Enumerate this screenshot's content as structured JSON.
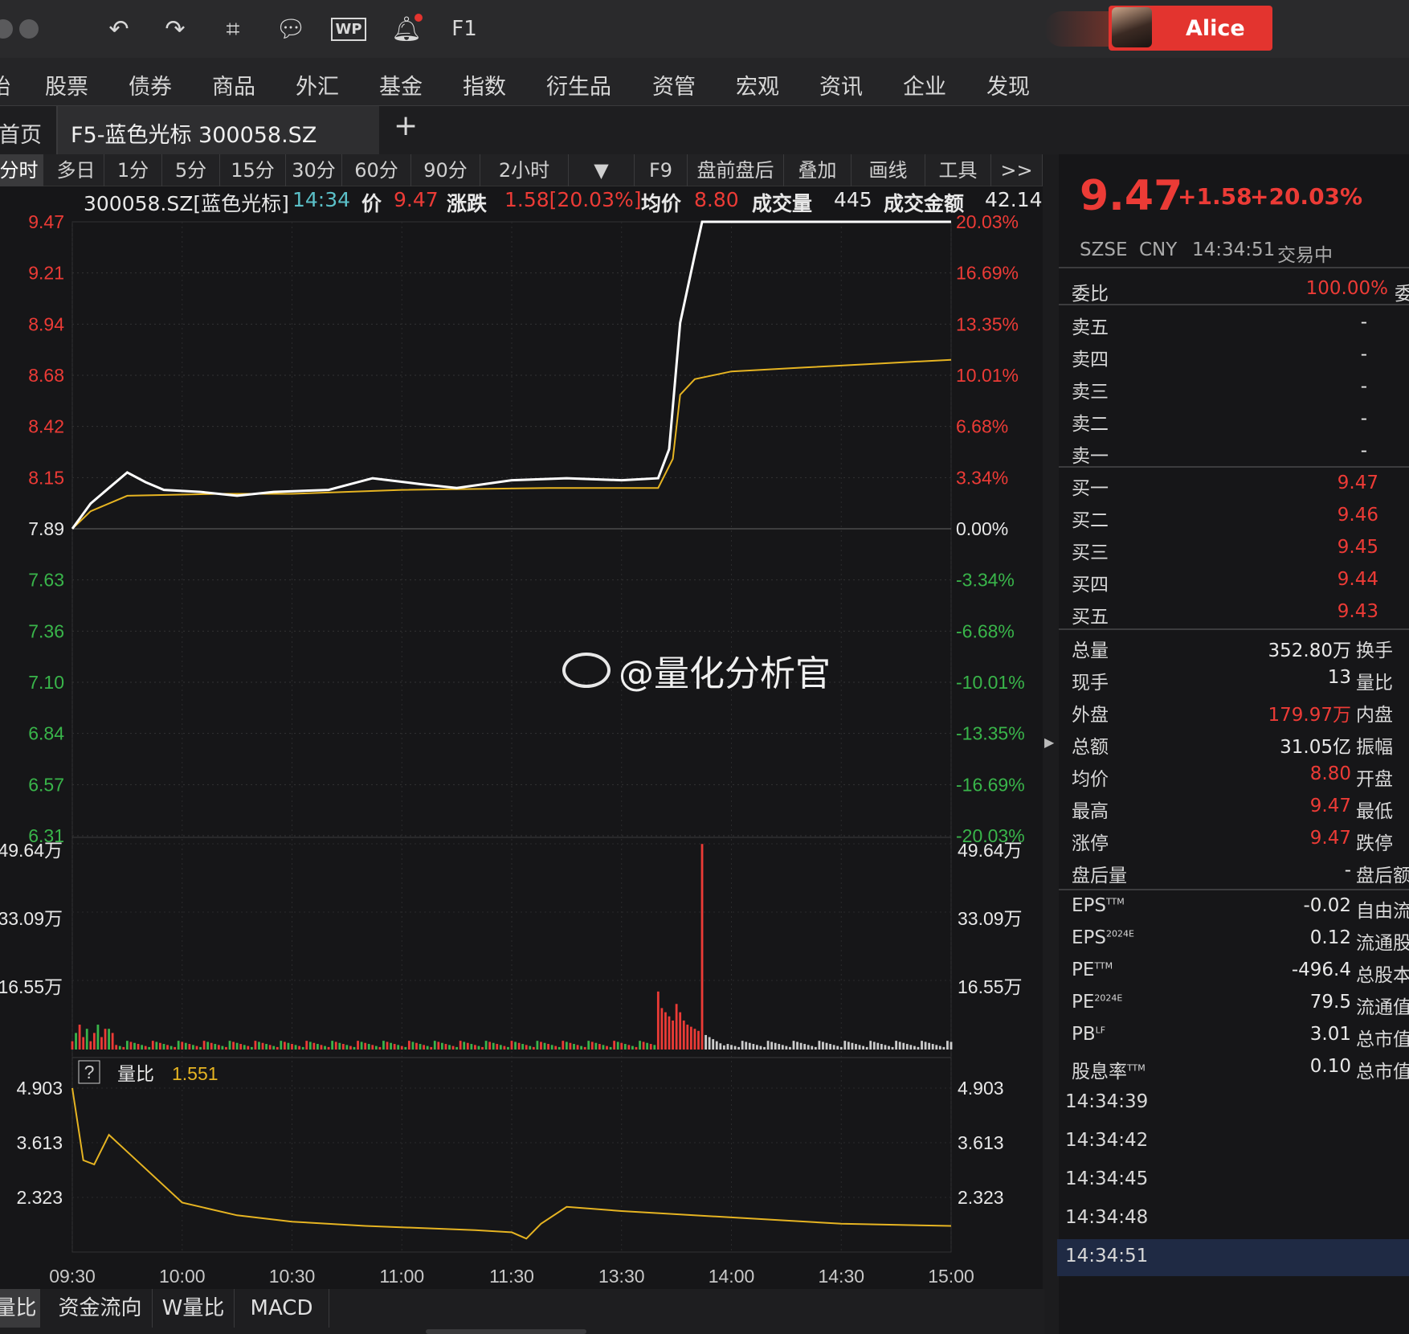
{
  "toolbar": {
    "user_name": "Alice",
    "f1_label": "F1"
  },
  "menu": [
    "股票",
    "债券",
    "商品",
    "外汇",
    "基金",
    "指数",
    "衍生品",
    "资管",
    "宏观",
    "资讯",
    "企业",
    "发现"
  ],
  "menu_cut": "始",
  "tabs": {
    "home": "首页",
    "active": "F5-蓝色光标 300058.SZ",
    "add": "+"
  },
  "periods": [
    "分时",
    "多日",
    "1分",
    "5分",
    "15分",
    "30分",
    "60分",
    "90分",
    "2小时",
    "F9",
    "盘前盘后",
    "叠加",
    "画线",
    "工具",
    ">>"
  ],
  "info": {
    "code": "300058.SZ[蓝色光标]",
    "time": "14:34",
    "price_label": "价",
    "price": "9.47",
    "change_label": "涨跌",
    "change": "1.58[20.03%]",
    "avg_label": "均价",
    "avg": "8.80",
    "vol_label": "成交量",
    "vol": "445",
    "amount_label": "成交金额",
    "amount": "42.14"
  },
  "watermark": "@量化分析官",
  "chart_data": {
    "type": "line",
    "price_axis": [
      "9.47",
      "9.21",
      "8.94",
      "8.68",
      "8.42",
      "8.15",
      "7.89",
      "7.63",
      "7.36",
      "7.10",
      "6.84",
      "6.57",
      "6.31"
    ],
    "pct_axis": [
      "20.03%",
      "16.69%",
      "13.35%",
      "10.01%",
      "6.68%",
      "3.34%",
      "0.00%",
      "-3.34%",
      "-6.68%",
      "-10.01%",
      "-13.35%",
      "-16.69%",
      "-20.03%"
    ],
    "volume_axis": [
      "49.64万",
      "33.09万",
      "16.55万"
    ],
    "ratio_label": "量比",
    "ratio_value": "1.551",
    "ratio_axis": [
      "4.903",
      "3.613",
      "2.323"
    ],
    "time_axis": [
      "09:30",
      "10:00",
      "10:30",
      "11:00",
      "11:30",
      "13:30",
      "14:00",
      "14:30",
      "15:00"
    ],
    "price_series": [
      [
        0,
        7.89
      ],
      [
        5,
        8.02
      ],
      [
        10,
        8.1
      ],
      [
        15,
        8.18
      ],
      [
        20,
        8.13
      ],
      [
        25,
        8.09
      ],
      [
        35,
        8.08
      ],
      [
        45,
        8.06
      ],
      [
        55,
        8.08
      ],
      [
        70,
        8.09
      ],
      [
        82,
        8.15
      ],
      [
        95,
        8.12
      ],
      [
        105,
        8.1
      ],
      [
        120,
        8.14
      ],
      [
        135,
        8.15
      ],
      [
        150,
        8.14
      ],
      [
        160,
        8.15
      ],
      [
        163,
        8.3
      ],
      [
        166,
        8.95
      ],
      [
        170,
        9.3
      ],
      [
        172,
        9.47
      ],
      [
        240,
        9.47
      ]
    ],
    "avg_series": [
      [
        0,
        7.89
      ],
      [
        5,
        7.98
      ],
      [
        15,
        8.06
      ],
      [
        40,
        8.07
      ],
      [
        60,
        8.07
      ],
      [
        90,
        8.09
      ],
      [
        130,
        8.1
      ],
      [
        160,
        8.1
      ],
      [
        164,
        8.25
      ],
      [
        166,
        8.58
      ],
      [
        170,
        8.66
      ],
      [
        180,
        8.7
      ],
      [
        200,
        8.72
      ],
      [
        220,
        8.74
      ],
      [
        240,
        8.76
      ]
    ],
    "ratio_series": [
      [
        0,
        4.903
      ],
      [
        3,
        3.2
      ],
      [
        6,
        3.1
      ],
      [
        10,
        3.8
      ],
      [
        15,
        3.4
      ],
      [
        30,
        2.2
      ],
      [
        45,
        1.9
      ],
      [
        60,
        1.75
      ],
      [
        80,
        1.65
      ],
      [
        110,
        1.55
      ],
      [
        120,
        1.5
      ],
      [
        124,
        1.35
      ],
      [
        128,
        1.7
      ],
      [
        135,
        2.1
      ],
      [
        150,
        2.0
      ],
      [
        180,
        1.85
      ],
      [
        210,
        1.7
      ],
      [
        240,
        1.65
      ]
    ],
    "volume_colors": {
      "up": "#ec3b36",
      "down": "#39b54a",
      "flat": "#cccccc"
    },
    "colors": {
      "price": "#ffffff",
      "avg": "#e6b422",
      "ratio": "#e6b422"
    }
  },
  "quote": {
    "price": "9.47",
    "change": "+1.58",
    "pct": "+20.03%",
    "exchange": "SZSE",
    "currency": "CNY",
    "time": "14:34:51",
    "status": "交易中"
  },
  "order_book": {
    "weibi_label": "委比",
    "weibi": "100.00%",
    "weibi_tail": "委",
    "asks": [
      {
        "label": "卖五",
        "value": "-"
      },
      {
        "label": "卖四",
        "value": "-"
      },
      {
        "label": "卖三",
        "value": "-"
      },
      {
        "label": "卖二",
        "value": "-"
      },
      {
        "label": "卖一",
        "value": "-"
      }
    ],
    "bids": [
      {
        "label": "买一",
        "value": "9.47"
      },
      {
        "label": "买二",
        "value": "9.46"
      },
      {
        "label": "买三",
        "value": "9.45"
      },
      {
        "label": "买四",
        "value": "9.44"
      },
      {
        "label": "买五",
        "value": "9.43"
      }
    ]
  },
  "stats": [
    {
      "label": "总量",
      "value": "352.80万",
      "tail": "换手",
      "color": "white"
    },
    {
      "label": "现手",
      "value": "13",
      "tail": "量比",
      "color": "white"
    },
    {
      "label": "外盘",
      "value": "179.97万",
      "tail": "内盘",
      "color": "red"
    },
    {
      "label": "总额",
      "value": "31.05亿",
      "tail": "振幅",
      "color": "white"
    },
    {
      "label": "均价",
      "value": "8.80",
      "tail": "开盘",
      "color": "red"
    },
    {
      "label": "最高",
      "value": "9.47",
      "tail": "最低",
      "color": "red"
    },
    {
      "label": "涨停",
      "value": "9.47",
      "tail": "跌停",
      "color": "red"
    },
    {
      "label": "盘后量",
      "value": "-",
      "tail": "盘后额",
      "color": "white"
    }
  ],
  "fundamentals": [
    {
      "label": "EPS",
      "sup": "TTM",
      "value": "-0.02",
      "tail": "自由流"
    },
    {
      "label": "EPS",
      "sup": "2024E",
      "value": "0.12",
      "tail": "流通股"
    },
    {
      "label": "PE",
      "sup": "TTM",
      "value": "-496.4",
      "tail": "总股本"
    },
    {
      "label": "PE",
      "sup": "2024E",
      "value": "79.5",
      "tail": "流通值"
    },
    {
      "label": "PB",
      "sup": "LF",
      "value": "3.01",
      "tail": "总市值"
    },
    {
      "label": "股息率",
      "sup": "TTM",
      "value": "0.10",
      "tail": "总市值"
    }
  ],
  "ticks": [
    "14:34:39",
    "14:34:42",
    "14:34:45",
    "14:34:48",
    "14:34:51"
  ],
  "bottom_tabs": [
    "量比",
    "资金流向",
    "W量比",
    "MACD"
  ]
}
